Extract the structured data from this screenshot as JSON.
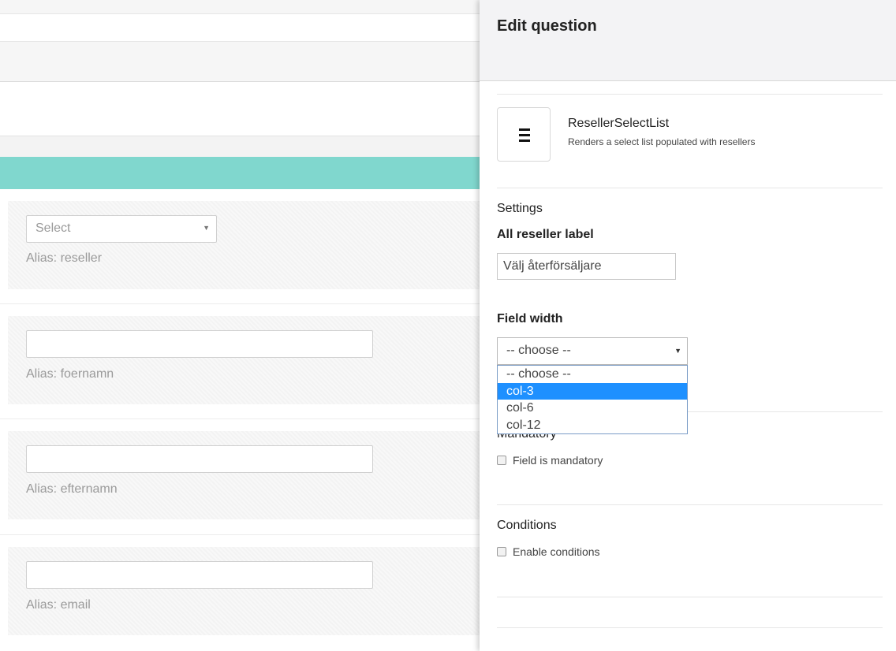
{
  "background_form": {
    "fields": [
      {
        "type": "select",
        "placeholder": "Select",
        "alias": "Alias: reseller"
      },
      {
        "type": "text",
        "alias": "Alias: foernamn"
      },
      {
        "type": "text",
        "alias": "Alias: efternamn"
      },
      {
        "type": "text",
        "alias": "Alias: email"
      }
    ]
  },
  "panel": {
    "title": "Edit question",
    "field_type": {
      "icon": "list-icon",
      "name": "ResellerSelectList",
      "description": "Renders a select list populated with resellers"
    },
    "settings": {
      "title": "Settings",
      "all_reseller_label": "All reseller label",
      "all_reseller_value": "Välj återförsäljare",
      "field_width_label": "Field width",
      "field_width_selected": "-- choose --",
      "field_width_options": [
        "-- choose --",
        "col-3",
        "col-6",
        "col-12"
      ],
      "highlighted_option": "col-3"
    },
    "mandatory": {
      "title": "Mandatory",
      "checkbox_label": "Field is mandatory"
    },
    "conditions": {
      "title": "Conditions",
      "checkbox_label": "Enable conditions"
    }
  }
}
